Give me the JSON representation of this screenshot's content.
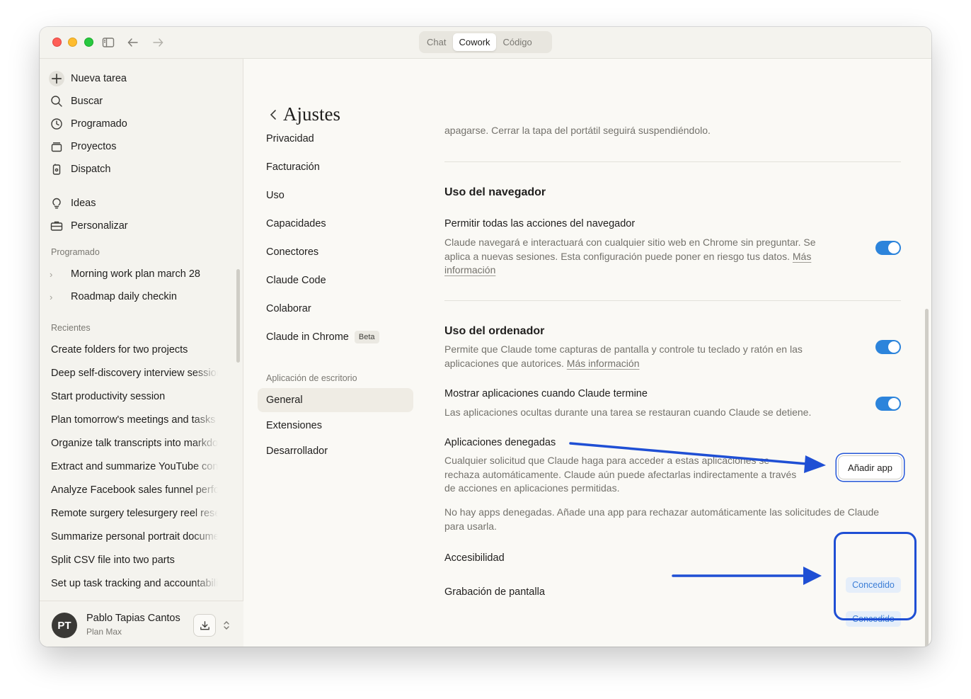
{
  "titlebar": {
    "tabs": [
      {
        "label": "Chat",
        "active": false
      },
      {
        "label": "Cowork",
        "active": true
      },
      {
        "label": "Código",
        "active": false
      }
    ]
  },
  "sidebar": {
    "new_task": "Nueva tarea",
    "nav": [
      {
        "label": "Buscar",
        "icon": "search-icon"
      },
      {
        "label": "Programado",
        "icon": "clock-icon"
      },
      {
        "label": "Proyectos",
        "icon": "folder-stack-icon"
      },
      {
        "label": "Dispatch",
        "icon": "phone-icon"
      },
      {
        "label": "Ideas",
        "icon": "lightbulb-icon"
      },
      {
        "label": "Personalizar",
        "icon": "briefcase-icon"
      }
    ],
    "scheduled_label": "Programado",
    "scheduled": [
      "Morning work plan march 28",
      "Roadmap daily checkin"
    ],
    "recents_label": "Recientes",
    "recents": [
      "Create folders for two projects",
      "Deep self-discovery interview session",
      "Start productivity session",
      "Plan tomorrow's meetings and tasks",
      "Organize talk transcripts into markdown",
      "Extract and summarize YouTube content",
      "Analyze Facebook sales funnel performance",
      "Remote surgery telesurgery reel research",
      "Summarize personal portrait document",
      "Split CSV file into two parts",
      "Set up task tracking and accountability"
    ],
    "user": {
      "initials": "PT",
      "name": "Pablo Tapias Cantos",
      "plan": "Plan Max"
    }
  },
  "settings_nav": {
    "title": "Ajustes",
    "items": [
      "Privacidad",
      "Facturación",
      "Uso",
      "Capacidades",
      "Conectores",
      "Claude Code",
      "Colaborar",
      "Claude in Chrome"
    ],
    "beta_badge": "Beta",
    "desktop_section": "Aplicación de escritorio",
    "desktop_items": [
      "General",
      "Extensiones",
      "Desarrollador"
    ],
    "active_item": "General"
  },
  "content": {
    "top_cut_text": "apagarse. Cerrar la tapa del portátil seguirá suspendiéndolo.",
    "browser": {
      "heading": "Uso del navegador",
      "allow_all_title": "Permitir todas las acciones del navegador",
      "allow_all_desc": "Claude navegará e interactuará con cualquier sitio web en Chrome sin preguntar. Se aplica a nuevas sesiones. Esta configuración puede poner en riesgo tus datos.",
      "allow_all_link": "Más información",
      "allow_all_enabled": true
    },
    "computer": {
      "heading": "Uso del ordenador",
      "desc": "Permite que Claude tome capturas de pantalla y controle tu teclado y ratón en las aplicaciones que autorices.",
      "link": "Más información",
      "enabled": true,
      "show_apps_title": "Mostrar aplicaciones cuando Claude termine",
      "show_apps_desc": "Las aplicaciones ocultas durante una tarea se restauran cuando Claude se detiene.",
      "show_apps_enabled": true,
      "denied_title": "Aplicaciones denegadas",
      "denied_desc": "Cualquier solicitud que Claude haga para acceder a estas aplicaciones se rechaza automáticamente. Claude aún puede afectarlas indirectamente a través de acciones en aplicaciones permitidas.",
      "add_app_label": "Añadir app",
      "no_denied": "No hay apps denegadas. Añade una app para rechazar automáticamente las solicitudes de Claude para usarla.",
      "permissions": [
        {
          "label": "Accesibilidad",
          "status": "Concedido"
        },
        {
          "label": "Grabación de pantalla",
          "status": "Concedido"
        }
      ]
    }
  },
  "colors": {
    "toggle_on": "#2c84db",
    "annotation": "#1f4fd4",
    "badge_bg": "#e5eefa",
    "badge_text": "#3b7dd6"
  }
}
